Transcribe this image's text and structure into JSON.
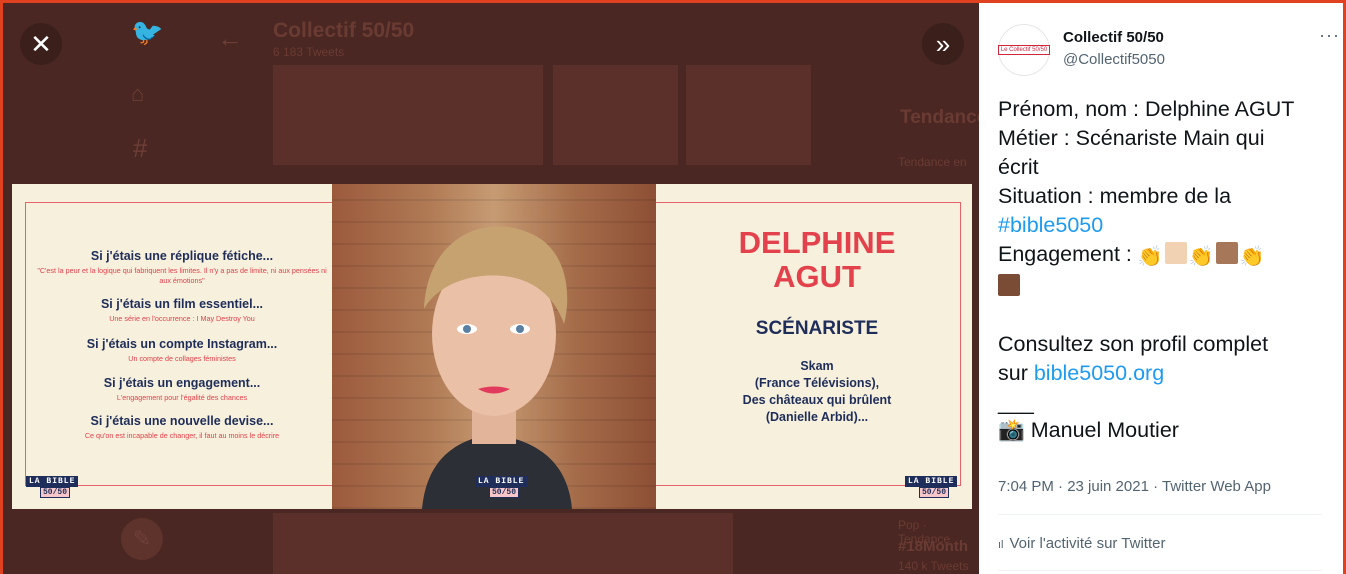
{
  "viewer": {
    "close_icon": "close-icon",
    "collapse_icon": "double-chevron-right-icon",
    "background": {
      "profile_name": "Collectif 50/50",
      "tweet_count": "6 183 Tweets",
      "trends_label": "Tendance",
      "trend_small": "Tendance en",
      "trend_hashtag": "#18Month",
      "bottom_small": "Pop · Tendance",
      "bottom_count": "140 k Tweets"
    },
    "poster": {
      "questions": [
        {
          "title": "Si j'étais une réplique fétiche...",
          "sub": "\"C'est la peur et la logique qui fabriquent les limites. Il n'y a pas de limite, ni aux pensées ni aux émotions\""
        },
        {
          "title": "Si j'étais un film essentiel...",
          "sub": "Une série en l'occurrence : I May Destroy You"
        },
        {
          "title": "Si j'étais un compte Instagram...",
          "sub": "Un compte de collages féministes"
        },
        {
          "title": "Si j'étais un engagement...",
          "sub": "L'engagement pour l'égalité des chances"
        },
        {
          "title": "Si j'étais une nouvelle devise...",
          "sub": "Ce qu'on est incapable de changer, il faut au moins le décrire"
        }
      ],
      "first_name": "DELPHINE",
      "last_name": "AGUT",
      "role": "SCÉNARISTE",
      "works_line1": "Skam",
      "works_line2": "(France Télévisions),",
      "works_line3": "Des châteaux qui brûlent",
      "works_line4": "(Danielle Arbid)...",
      "logo_top": "LA BIBLE",
      "logo_bottom": "50/50"
    }
  },
  "tweet": {
    "avatar_text": "Le Collectif 50/50",
    "display_name": "Collectif 50/50",
    "handle": "@Collectif5050",
    "more_label": "···",
    "line1": "Prénom, nom : Delphine AGUT",
    "line2": "Métier : Scénariste Main qui",
    "line3": "écrit",
    "line4": "Situation : membre de la",
    "hashtag": "#bible5050",
    "engagement_label": "Engagement : ",
    "emoji_clap": "👏",
    "line_consult1": "Consultez son profil complet",
    "line_consult_prefix": "sur ",
    "profile_link": "bible5050.org",
    "divider": "___",
    "photo_credit_icon": "📸",
    "photo_credit": " Manuel Moutier",
    "timestamp": "7:04 PM · 23 juin 2021 · Twitter Web App",
    "activity_icon": "ıl",
    "activity": "Voir l'activité sur Twitter",
    "colors": {
      "link": "#1d9bf0",
      "skin_light": "#f1d3b3",
      "skin_medium": "#a67859",
      "skin_dark": "#7a4b35"
    }
  }
}
